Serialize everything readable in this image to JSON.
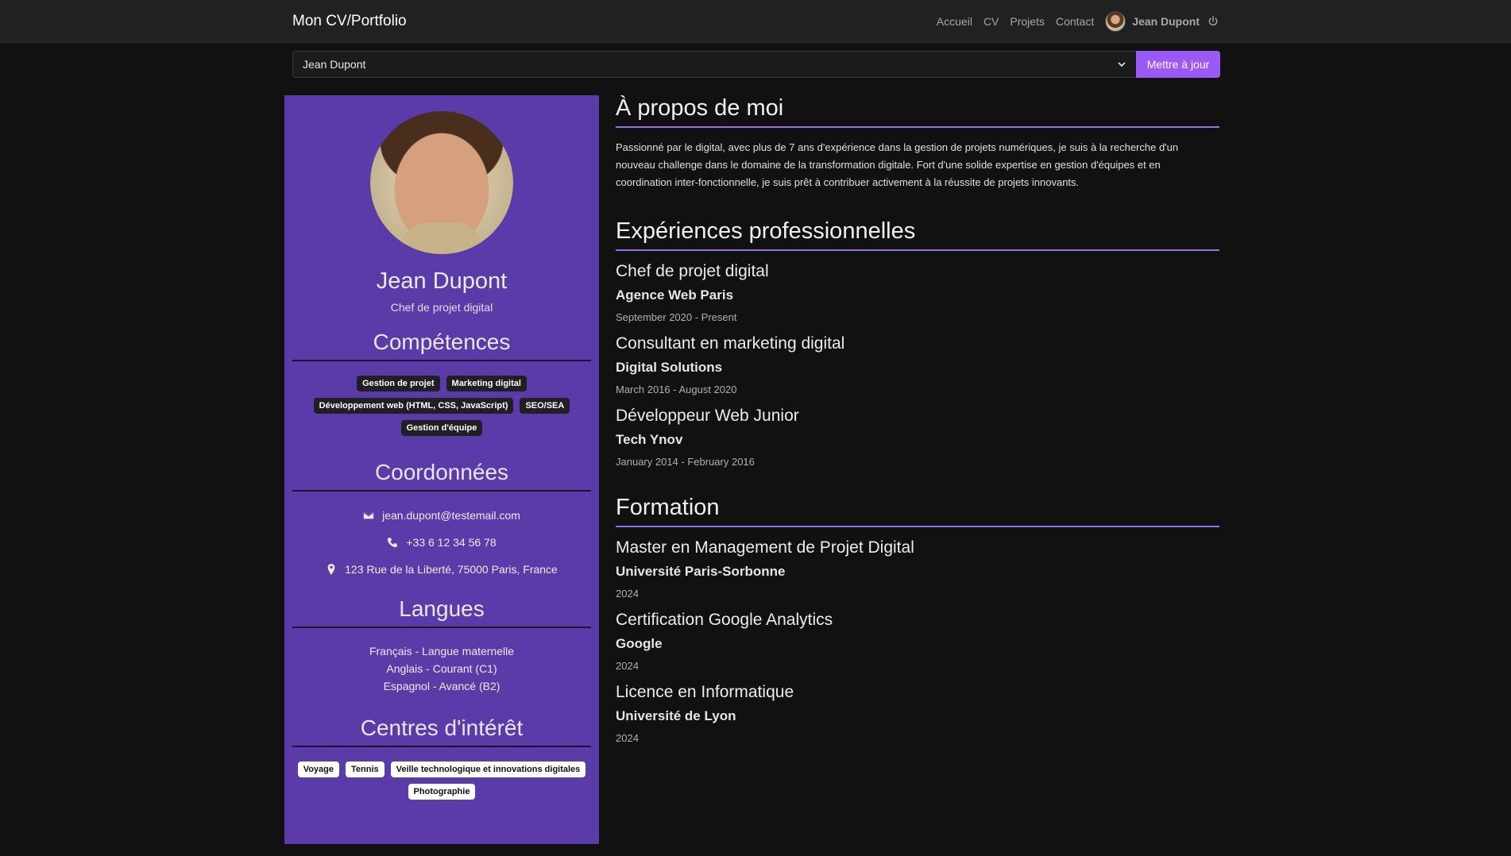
{
  "navbar": {
    "brand": "Mon CV/Portfolio",
    "links": [
      "Accueil",
      "CV",
      "Projets",
      "Contact"
    ],
    "user_name": "Jean Dupont"
  },
  "selector": {
    "selected": "Jean Dupont",
    "button_label": "Mettre à jour"
  },
  "sidebar": {
    "name": "Jean Dupont",
    "title": "Chef de projet digital",
    "skills_heading": "Compétences",
    "skills": [
      "Gestion de projet",
      "Marketing digital",
      "Développement web (HTML, CSS, JavaScript)",
      "SEO/SEA",
      "Gestion d'équipe"
    ],
    "contact_heading": "Coordonnées",
    "email": "jean.dupont@testemail.com",
    "phone": "+33 6 12 34 56 78",
    "address": "123 Rue de la Liberté, 75000 Paris, France",
    "languages_heading": "Langues",
    "languages": [
      "Français - Langue maternelle",
      "Anglais - Courant (C1)",
      "Espagnol - Avancé (B2)"
    ],
    "interests_heading": "Centres d'intérêt",
    "interests": [
      "Voyage",
      "Tennis",
      "Veille technologique et innovations digitales",
      "Photographie"
    ]
  },
  "main": {
    "about_heading": "À propos de moi",
    "about_text": "Passionné par le digital, avec plus de 7 ans d'expérience dans la gestion de projets numériques, je suis à la recherche d'un nouveau challenge dans le domaine de la transformation digitale. Fort d'une solide expertise en gestion d'équipes et en coordination inter-fonctionnelle, je suis prêt à contribuer activement à la réussite de projets innovants.",
    "experience_heading": "Expériences professionnelles",
    "experiences": [
      {
        "title": "Chef de projet digital",
        "org": "Agence Web Paris",
        "date": "September 2020 - Present"
      },
      {
        "title": "Consultant en marketing digital",
        "org": "Digital Solutions",
        "date": "March 2016 - August 2020"
      },
      {
        "title": "Développeur Web Junior",
        "org": "Tech Ynov",
        "date": "January 2014 - February 2016"
      }
    ],
    "education_heading": "Formation",
    "education": [
      {
        "title": "Master en Management de Projet Digital",
        "org": "Université Paris-Sorbonne",
        "date": "2024"
      },
      {
        "title": "Certification Google Analytics",
        "org": "Google",
        "date": "2024"
      },
      {
        "title": "Licence en Informatique",
        "org": "Université de Lyon",
        "date": "2024"
      }
    ]
  },
  "icons": {
    "email": "envelope-icon",
    "phone": "phone-icon",
    "address": "map-pin-icon",
    "dropdown": "chevron-down-icon",
    "logout": "power-icon"
  },
  "colors": {
    "accent": "#9b59f6",
    "sidebar": "#5b3ba7",
    "background": "#111111",
    "navbar": "#212121"
  }
}
